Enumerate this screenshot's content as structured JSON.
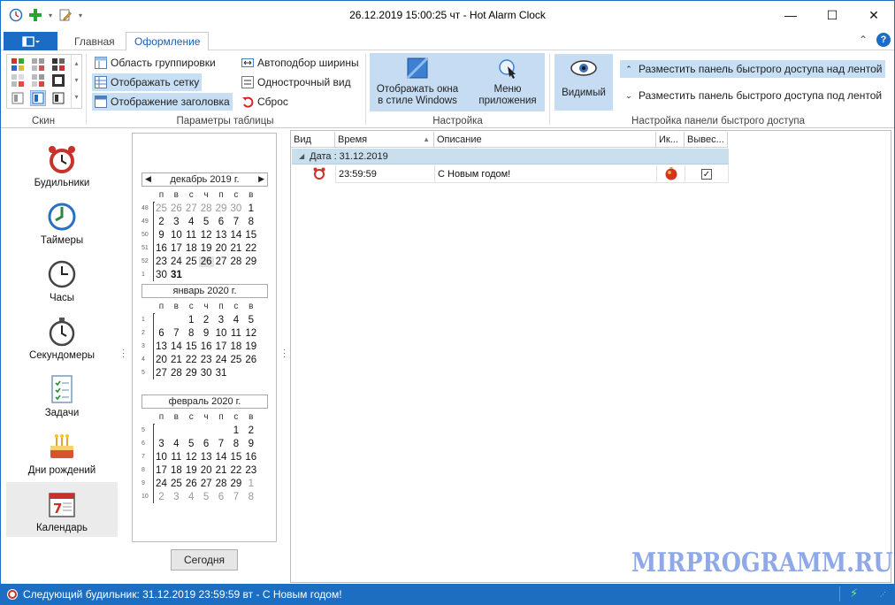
{
  "window": {
    "title": "26.12.2019 15:00:25 чт - Hot Alarm Clock",
    "minimize": "—",
    "maximize": "☐",
    "close": "✕"
  },
  "ribbon_tabs": {
    "tab1": "Главная",
    "tab2": "Оформление"
  },
  "groups": {
    "skin": "Скин",
    "table": "Параметры таблицы",
    "settings": "Настройка",
    "qat": "Настройка панели быстрого доступа"
  },
  "table_opts": {
    "grouping_area": "Область группировки",
    "show_grid": "Отображать сетку",
    "show_header": "Отображение заголовка",
    "auto_width": "Автоподбор ширины",
    "single_line": "Однострочный вид",
    "reset": "Сброс"
  },
  "settings": {
    "windows_style": "Отображать окна\nв стиле Windows",
    "app_menu": "Меню\nприложения",
    "visible": "Видимый"
  },
  "qat_opts": {
    "above": "Разместить панель быстрого доступа над лентой",
    "below": "Разместить панель быстрого доступа под лентой"
  },
  "nav": {
    "alarms": "Будильники",
    "timers": "Таймеры",
    "clocks": "Часы",
    "stopwatches": "Секундомеры",
    "tasks": "Задачи",
    "birthdays": "Дни рождений",
    "calendar": "Календарь"
  },
  "calendar": {
    "dow": [
      "п",
      "в",
      "с",
      "ч",
      "п",
      "с",
      "в"
    ],
    "months": [
      {
        "name": "декабрь 2019 г.",
        "weeks": [
          {
            "n": "48",
            "d": [
              "25",
              "26",
              "27",
              "28",
              "29",
              "30",
              "1"
            ]
          },
          {
            "n": "49",
            "d": [
              "2",
              "3",
              "4",
              "5",
              "6",
              "7",
              "8"
            ]
          },
          {
            "n": "50",
            "d": [
              "9",
              "10",
              "11",
              "12",
              "13",
              "14",
              "15"
            ]
          },
          {
            "n": "51",
            "d": [
              "16",
              "17",
              "18",
              "19",
              "20",
              "21",
              "22"
            ]
          },
          {
            "n": "52",
            "d": [
              "23",
              "24",
              "25",
              "26",
              "27",
              "28",
              "29"
            ]
          },
          {
            "n": "1",
            "d": [
              "30",
              "31",
              "",
              "",
              "",
              "",
              ""
            ]
          }
        ]
      },
      {
        "name": "январь 2020 г.",
        "weeks": [
          {
            "n": "1",
            "d": [
              "",
              "",
              "1",
              "2",
              "3",
              "4",
              "5"
            ]
          },
          {
            "n": "2",
            "d": [
              "6",
              "7",
              "8",
              "9",
              "10",
              "11",
              "12"
            ]
          },
          {
            "n": "3",
            "d": [
              "13",
              "14",
              "15",
              "16",
              "17",
              "18",
              "19"
            ]
          },
          {
            "n": "4",
            "d": [
              "20",
              "21",
              "22",
              "23",
              "24",
              "25",
              "26"
            ]
          },
          {
            "n": "5",
            "d": [
              "27",
              "28",
              "29",
              "30",
              "31",
              "",
              ""
            ]
          }
        ]
      },
      {
        "name": "февраль 2020 г.",
        "weeks": [
          {
            "n": "5",
            "d": [
              "",
              "",
              "",
              "",
              "",
              "1",
              "2"
            ]
          },
          {
            "n": "6",
            "d": [
              "3",
              "4",
              "5",
              "6",
              "7",
              "8",
              "9"
            ]
          },
          {
            "n": "7",
            "d": [
              "10",
              "11",
              "12",
              "13",
              "14",
              "15",
              "16"
            ]
          },
          {
            "n": "8",
            "d": [
              "17",
              "18",
              "19",
              "20",
              "21",
              "22",
              "23"
            ]
          },
          {
            "n": "9",
            "d": [
              "24",
              "25",
              "26",
              "27",
              "28",
              "29",
              "1"
            ]
          },
          {
            "n": "10",
            "d": [
              "2",
              "3",
              "4",
              "5",
              "6",
              "7",
              "8"
            ]
          }
        ]
      }
    ],
    "today_button": "Сегодня"
  },
  "grid": {
    "columns": [
      "Вид",
      "Время",
      "Описание",
      "Ик...",
      "Вывес..."
    ],
    "group_label": "Дата : 31.12.2019",
    "row": {
      "time": "23:59:59",
      "description": "С Новым годом!"
    }
  },
  "watermark": "MIRPROGRAMM.RU",
  "status": {
    "text": "Следующий будильник: 31.12.2019 23:59:59 вт - С Новым годом!"
  }
}
